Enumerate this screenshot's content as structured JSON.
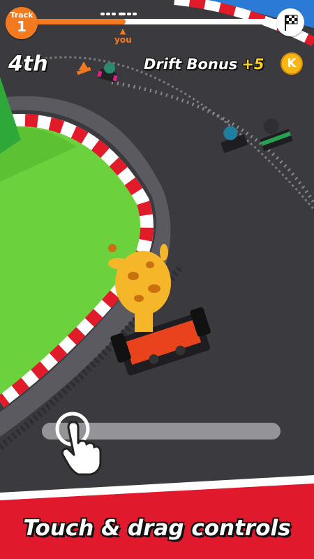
{
  "hud": {
    "track_label": "Track",
    "track_number": "1",
    "race_progress": 0.37,
    "you_label": "you",
    "position": "4th",
    "drift_label": "Drift Bonus",
    "drift_bonus": "+5",
    "coin_symbol": "K",
    "finish_icon": "checkered-flag-icon"
  },
  "controls": {
    "hint_icon": "tap-hand-icon"
  },
  "banner": {
    "text": "Touch & drag controls"
  },
  "colors": {
    "accent": "#f47a1f",
    "grass": "#6bd13d",
    "asphalt": "#3b3b3f",
    "curb_red": "#e21b2b",
    "banner_red": "#e1192c",
    "coin_gold": "#f6b716",
    "bonus_yellow": "#ffd21c"
  }
}
